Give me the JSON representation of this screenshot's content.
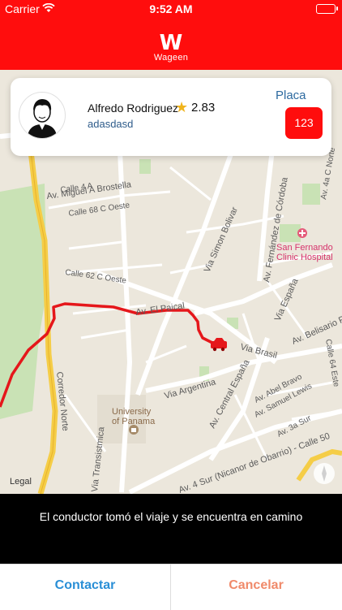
{
  "status_bar": {
    "carrier": "Carrier",
    "time": "9:52 AM"
  },
  "header": {
    "logo_mark": "W",
    "logo_word": "Wageen"
  },
  "driver": {
    "name": "Alfredo Rodriguez",
    "rating": "2.83",
    "subtitle": "adasdasd",
    "plate_label": "Placa",
    "plate_number": "123"
  },
  "map": {
    "labels": {
      "brostella": "Av. Miguel A Brostella",
      "calle4a": "Calle 4 A",
      "calle68": "Calle 68 C Oeste",
      "calle62": "Calle 62 C Oeste",
      "elpaical": "Av. El Paical",
      "simon": "Via Simon Bolivar",
      "fernandez": "Av. Fernández de Córdoba",
      "sanfernando1": "San Fernando",
      "sanfernando2": "Clinic Hospital",
      "espana": "Via España",
      "belisario": "Av. Belisario Por",
      "brasil": "Via Brasil",
      "calle64": "Calle 64 Este",
      "calle4anorte": "Av. 4a C Norte",
      "argentina": "Via Argentina",
      "centralespana": "Av. Central España",
      "abelbravo": "Av. Abel Bravo",
      "samuellewis": "Av. Samuel Lewis",
      "calle3a": "Av. 3a Sur",
      "corredor": "Corredor Norte",
      "univ1": "University",
      "univ2": "of Panama",
      "transistmica": "Via Transistmica",
      "avsur": "Av. 4 Sur (Nicanor de Obarrio) - Calle 50",
      "legal": "Legal"
    }
  },
  "banner": {
    "message": "El conductor tomó el viaje y se encuentra en camino"
  },
  "actions": {
    "contact_label": "Contactar",
    "cancel_label": "Cancelar"
  },
  "colors": {
    "brand_red": "#ff0d0d",
    "contact_blue": "#2a8fd6",
    "cancel_salmon": "#f08a6a",
    "route_red": "#e5171b"
  },
  "icons": [
    "wifi-icon",
    "battery-icon",
    "wageen-logo",
    "driver-avatar-icon",
    "star-icon",
    "car-icon",
    "hospital-icon",
    "university-icon",
    "compass-icon"
  ]
}
